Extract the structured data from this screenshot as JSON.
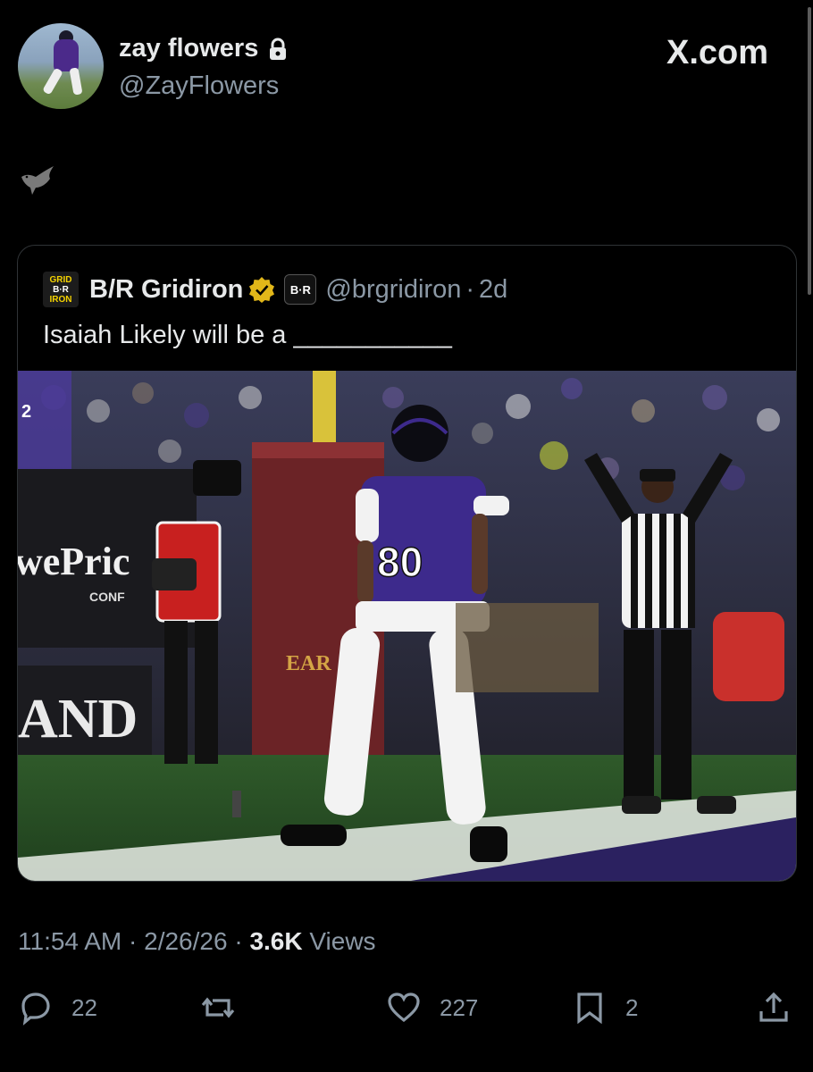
{
  "author": {
    "display_name": "zay flowers",
    "handle": "@ZayFlowers",
    "avatar": "player-avatar",
    "lock_icon": "lock-icon"
  },
  "watermark": "X.com",
  "post_icon": "bird-icon",
  "quoted": {
    "logo_lines": [
      "GRID",
      "B·R",
      "IRON"
    ],
    "name": "B/R Gridiron",
    "badge_icon": "gold-verified-icon",
    "affiliate_badge": "B·R",
    "handle": "@brgridiron",
    "dot": "·",
    "time": "2d",
    "text": "Isaiah Likely will be a ___________",
    "photo": {
      "description_icon": "football-touchdown-photo",
      "jersey_number": "80",
      "banner_text": "AND",
      "sign_text": "wePric",
      "sign_sub": "CONF",
      "post_text": "EAR",
      "fan_number": "2"
    }
  },
  "meta": {
    "time": "11:54 AM",
    "sep1": "·",
    "date": "2/26/26",
    "sep2": "·",
    "views_count": "3.6K",
    "views_label": "Views"
  },
  "actions": {
    "replies": "22",
    "reposts": "",
    "likes": "227",
    "bookmarks": "2"
  },
  "colors": {
    "background": "#000000",
    "text": "#e7e9ea",
    "secondary": "#8b98a5",
    "border": "#2f3336",
    "ravens_purple": "#3d2a8c",
    "verified_gold": "#e2b719"
  }
}
